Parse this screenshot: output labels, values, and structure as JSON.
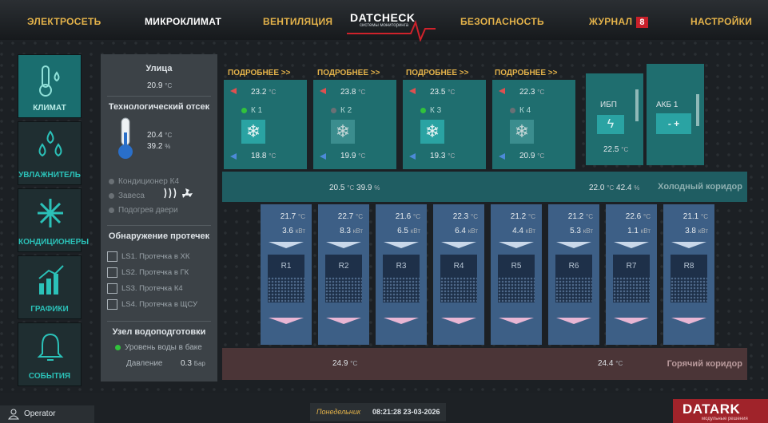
{
  "nav": {
    "items": [
      "ЭЛЕКТРОСЕТЬ",
      "МИКРОКЛИМАТ",
      "ВЕНТИЛЯЦИЯ",
      "БЕЗОПАСНОСТЬ",
      "ЖУРНАЛ",
      "НАСТРОЙКИ"
    ],
    "journal_badge": "8",
    "active": "МИКРОКЛИМАТ"
  },
  "logo": {
    "name": "DATCHECK",
    "tagline": "системы мониторинга"
  },
  "sidebar": {
    "items": [
      {
        "label": "КЛИМАТ",
        "icon": "thermometer-drops-icon",
        "active": true
      },
      {
        "label": "УВЛАЖНИТЕЛЬ",
        "icon": "humidifier-drops-icon"
      },
      {
        "label": "КОНДИЦИОНЕРЫ",
        "icon": "snowflake-icon"
      },
      {
        "label": "ГРАФИКИ",
        "icon": "bar-chart-icon"
      },
      {
        "label": "СОБЫТИЯ",
        "icon": "bell-icon"
      }
    ]
  },
  "left_panel": {
    "street_title": "Улица",
    "street_temp": "20.9",
    "tech_title": "Технологический отсек",
    "tech_temp": "20.4",
    "tech_hum": "39.2",
    "unit_c": "°C",
    "unit_pct": "%",
    "devices": [
      "Кондиционер К4",
      "Завеса",
      "Подогрев двери"
    ],
    "leak_title": "Обнаружение протечек",
    "leaks": [
      "LS1. Протечка в ХК",
      "LS2. Протечка в ГК",
      "LS3. Протечка К4",
      "LS4. Протечка в ЩСУ"
    ],
    "water_title": "Узел водоподготовки",
    "water_level": "Уровень воды в баке",
    "pressure_label": "Давление",
    "pressure_value": "0.3",
    "pressure_unit": "Бар"
  },
  "more_label": "ПОДРОБНЕЕ >>",
  "conditioners": [
    {
      "name": "К 1",
      "t_in": "23.2",
      "t_out": "18.8",
      "on": true
    },
    {
      "name": "К 2",
      "t_in": "23.8",
      "t_out": "19.9",
      "on": false
    },
    {
      "name": "К 3",
      "t_in": "23.5",
      "t_out": "19.3",
      "on": true
    },
    {
      "name": "К 4",
      "t_in": "22.3",
      "t_out": "20.9",
      "on": false
    }
  ],
  "ups": {
    "label": "ИБП",
    "temp": "22.5"
  },
  "akb": {
    "label": "АКБ 1"
  },
  "cold_corridor": {
    "label": "Холодный коридор",
    "left": "20.5",
    "left_hum": "39.9",
    "right": "22.0",
    "right_hum": "42.4"
  },
  "hot_corridor": {
    "label": "Горячий коридор",
    "left": "24.9",
    "right": "24.4"
  },
  "racks": [
    {
      "name": "R1",
      "temp": "21.7",
      "power": "3.6"
    },
    {
      "name": "R2",
      "temp": "22.7",
      "power": "8.3"
    },
    {
      "name": "R3",
      "temp": "21.6",
      "power": "6.5"
    },
    {
      "name": "R4",
      "temp": "22.3",
      "power": "6.4"
    },
    {
      "name": "R5",
      "temp": "21.2",
      "power": "4.4"
    },
    {
      "name": "R6",
      "temp": "21.2",
      "power": "5.3"
    },
    {
      "name": "R7",
      "temp": "22.6",
      "power": "1.1"
    },
    {
      "name": "R8",
      "temp": "21.1",
      "power": "3.8"
    }
  ],
  "unit_kw": "кВт",
  "footer": {
    "user": "Operator",
    "day": "Понедельник",
    "time": "08:21:28 23-03-2026",
    "brand": "DATARK",
    "brand_sub": "модульные решения"
  },
  "colors": {
    "accent": "#e3b24a",
    "teal": "#1f6e6f",
    "rack": "#3d5f86",
    "alert": "#c8202a"
  }
}
